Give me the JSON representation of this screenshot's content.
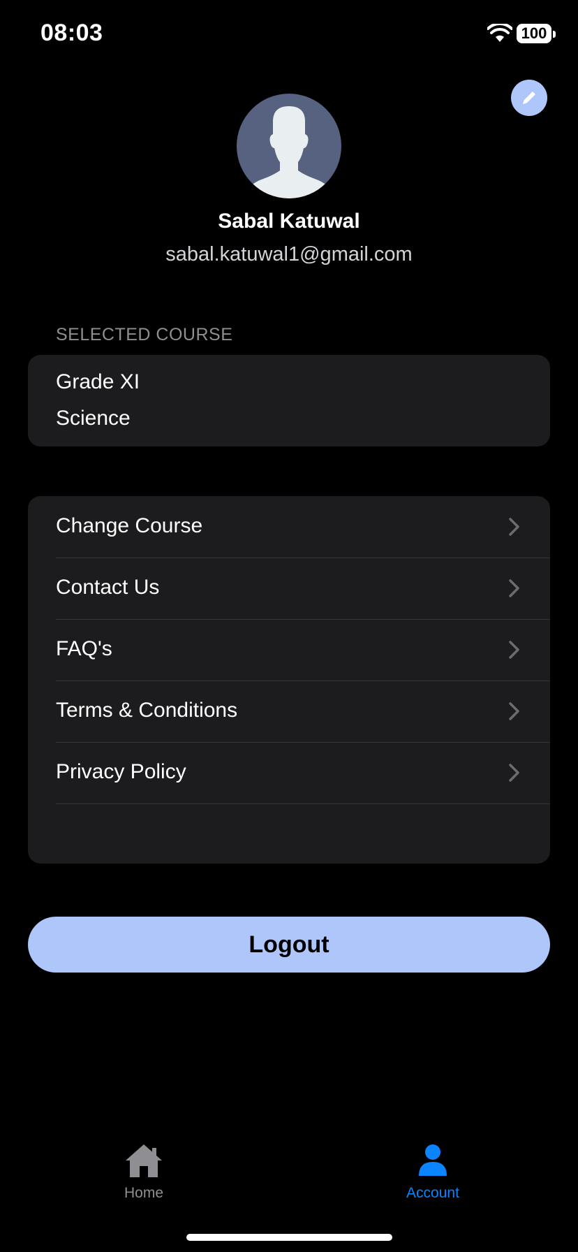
{
  "status_bar": {
    "time": "08:03",
    "battery": "100"
  },
  "profile": {
    "name": "Sabal Katuwal",
    "email": "sabal.katuwal1@gmail.com"
  },
  "selected_course": {
    "label": "SELECTED COURSE",
    "lines": [
      "Grade XI",
      "Science"
    ]
  },
  "menu": {
    "items": [
      {
        "label": "Change Course"
      },
      {
        "label": "Contact Us"
      },
      {
        "label": "FAQ's"
      },
      {
        "label": "Terms & Conditions"
      },
      {
        "label": "Privacy Policy"
      }
    ]
  },
  "logout_label": "Logout",
  "tab_bar": {
    "tabs": [
      {
        "label": "Home",
        "icon": "house-icon",
        "active": false
      },
      {
        "label": "Account",
        "icon": "person-icon",
        "active": true
      }
    ]
  },
  "colors": {
    "accent": "#aec6fa",
    "active_tab": "#0a84ff",
    "inactive_tab": "#8e8e93",
    "card": "#1c1c1e"
  }
}
